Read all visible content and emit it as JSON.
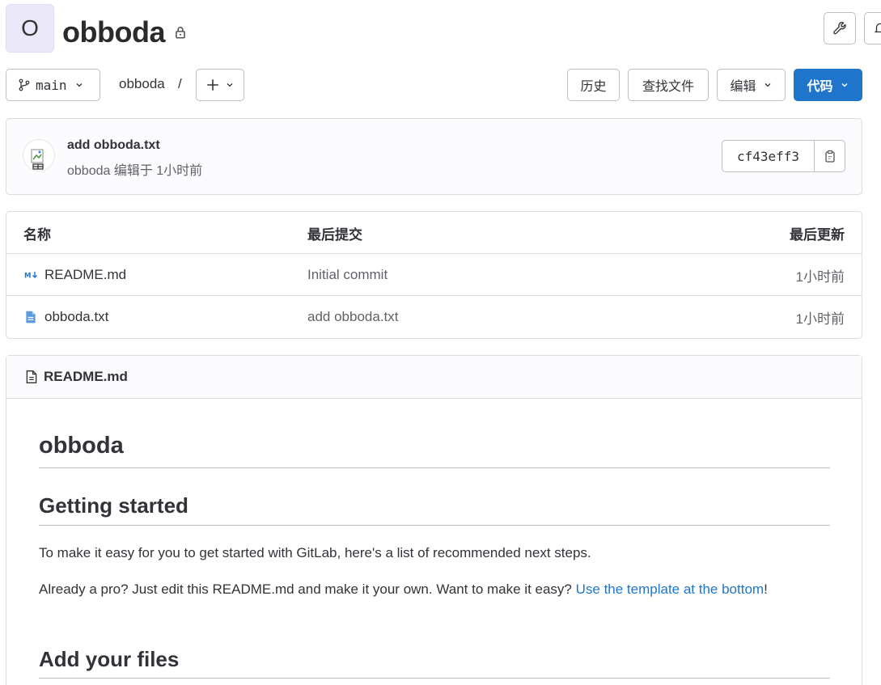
{
  "project": {
    "avatar_letter": "O",
    "name": "obboda",
    "visibility_icon": "lock-icon"
  },
  "toolbar": {
    "branch": "main",
    "breadcrumb_root": "obboda",
    "breadcrumb_sep": "/",
    "add_icon": "plus-icon",
    "history_label": "历史",
    "find_file_label": "查找文件",
    "edit_label": "编辑",
    "code_label": "代码"
  },
  "last_commit": {
    "title": "add obboda.txt",
    "subtitle": "obboda 编辑于 1小时前",
    "sha": "cf43eff3"
  },
  "file_table": {
    "headers": {
      "name": "名称",
      "last_commit": "最后提交",
      "last_update": "最后更新"
    },
    "rows": [
      {
        "name": "README.md",
        "icon": "markdown-icon",
        "commit": "Initial commit",
        "updated": "1小时前"
      },
      {
        "name": "obboda.txt",
        "icon": "text-file-icon",
        "commit": "add obboda.txt",
        "updated": "1小时前"
      }
    ]
  },
  "readme": {
    "file_name": "README.md",
    "h1": "obboda",
    "h2_getting_started": "Getting started",
    "p1": "To make it easy for you to get started with GitLab, here's a list of recommended next steps.",
    "p2_prefix": "Already a pro? Just edit this README.md and make it your own. Want to make it easy? ",
    "p2_link": "Use the template at the bottom",
    "p2_suffix": "!",
    "h2_add_files": "Add your files"
  },
  "colors": {
    "primary": "#1f75cb",
    "text": "#333238",
    "muted": "#626168",
    "border": "#dcdcde"
  }
}
